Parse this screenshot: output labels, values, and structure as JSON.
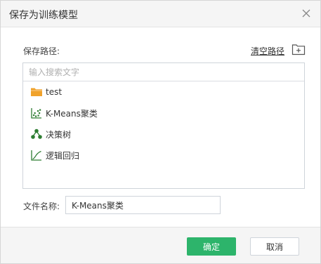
{
  "dialog": {
    "title": "保存为训练模型",
    "close_icon": "close-icon"
  },
  "path": {
    "label": "保存路径:",
    "clear_link": "清空路径",
    "add_folder_icon": "folder-add-icon"
  },
  "search": {
    "placeholder": "输入搜索文字",
    "value": ""
  },
  "items": [
    {
      "label": "test",
      "icon": "folder-icon",
      "color": "#f0a22b"
    },
    {
      "label": "K-Means聚类",
      "icon": "kmeans-scatter-icon",
      "color": "#2e7d32"
    },
    {
      "label": "决策树",
      "icon": "decision-tree-icon",
      "color": "#2e7d32"
    },
    {
      "label": "逻辑回归",
      "icon": "logistic-regression-icon",
      "color": "#2e7d32"
    }
  ],
  "filename": {
    "label": "文件名称:",
    "value": "K-Means聚类"
  },
  "buttons": {
    "ok": "确定",
    "cancel": "取消"
  },
  "colors": {
    "accent": "#2db46b",
    "folder": "#f0a22b",
    "model_icon": "#2e7d32"
  }
}
